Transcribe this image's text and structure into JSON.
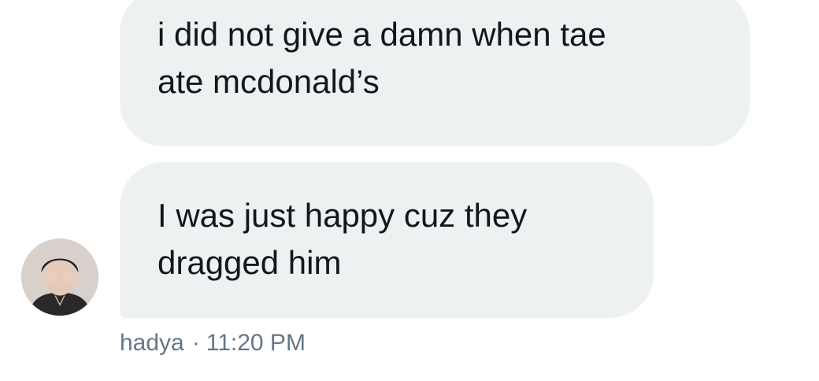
{
  "messages": [
    {
      "lines": [
        "i did not give a damn when tae",
        "ate mcdonald’s"
      ]
    },
    {
      "lines": [
        "I was just happy cuz they",
        "dragged him"
      ]
    }
  ],
  "sender": {
    "name": "hadya",
    "separator": "·",
    "time": "11:20 PM",
    "avatar_icon": "user-avatar-photo"
  },
  "colors": {
    "bubble_background": "#eef1f2",
    "message_text": "#14171a",
    "meta_text": "#657786"
  }
}
